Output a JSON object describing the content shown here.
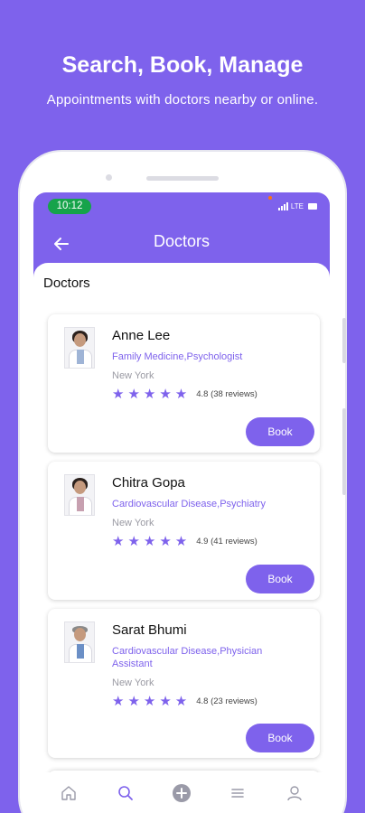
{
  "promo": {
    "headline": "Search, Book, Manage",
    "subline": "Appointments with doctors nearby or online."
  },
  "status_bar": {
    "time": "10:12",
    "network": "LTE"
  },
  "app_bar": {
    "title": "Doctors",
    "back_icon": "arrow-left-icon"
  },
  "section_title": "Doctors",
  "doctors": [
    {
      "name": "Anne Lee",
      "specialty": "Family Medicine,Psychologist",
      "location": "New York",
      "stars": "★★★★★",
      "rating": "4.8 (38 reviews)",
      "book_label": "Book"
    },
    {
      "name": "Chitra Gopa",
      "specialty": "Cardiovascular Disease,Psychiatry",
      "location": "New York",
      "stars": "★★★★★",
      "rating": "4.9 (41 reviews)",
      "book_label": "Book"
    },
    {
      "name": "Sarat Bhumi",
      "specialty": "Cardiovascular Disease,Physician Assistant",
      "location": "New York",
      "stars": "★★★★★",
      "rating": "4.8 (23 reviews)",
      "book_label": "Book"
    }
  ],
  "bottom_nav": [
    {
      "icon": "home-icon",
      "active": false
    },
    {
      "icon": "search-icon",
      "active": true
    },
    {
      "icon": "plus-circle-icon",
      "active": false
    },
    {
      "icon": "menu-icon",
      "active": false
    },
    {
      "icon": "profile-icon",
      "active": false
    }
  ],
  "colors": {
    "brand": "#7e62ec",
    "status_pill": "#16a34a",
    "surface": "#ffffff"
  }
}
